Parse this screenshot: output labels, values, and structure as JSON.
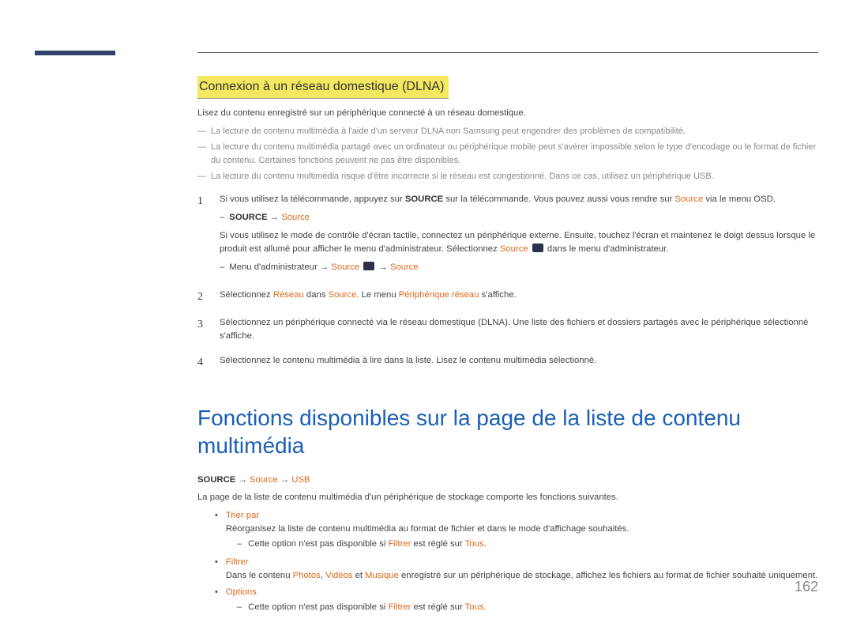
{
  "section": {
    "title": "Connexion à un réseau domestique (DLNA)",
    "intro": "Lisez du contenu enregistré sur un périphérique connecté à un réseau domestique.",
    "notes": [
      "La lecture de contenu multimédia à l'aide d'un serveur DLNA non Samsung peut engendrer des problèmes de compatibilité.",
      "La lecture du contenu multimédia partagé avec un ordinateur ou périphérique mobile peut s'avérer impossible selon le type d'encodage ou le format de fichier du contenu. Certaines fonctions peuvent ne pas être disponibles.",
      "La lecture du contenu multimédia risque d'être incorrecte si le réseau est congestionné. Dans ce cas, utilisez un périphérique USB."
    ]
  },
  "steps": {
    "s1": {
      "num": "1",
      "line1_a": "Si vous utilisez la télécommande, appuyez sur ",
      "line1_b": "SOURCE",
      "line1_c": " sur la télécommande. Vous pouvez aussi vous rendre sur ",
      "line1_d": "Source",
      "line1_e": " via le menu OSD.",
      "sub1_a": "SOURCE",
      "sub1_arrow": " → ",
      "sub1_b": "Source",
      "line2_a": "Si vous utilisez le mode de contrôle d'écran tactile, connectez un périphérique externe. Ensuite, touchez l'écran et maintenez le doigt dessus lorsque le produit est allumé pour afficher le menu d'administrateur. Sélectionnez ",
      "line2_b": "Source",
      "line2_c": " dans le menu d'administrateur.",
      "sub2_a": "Menu d'administrateur → ",
      "sub2_b": "Source",
      "sub2_c": " → ",
      "sub2_d": "Source"
    },
    "s2": {
      "num": "2",
      "a": "Sélectionnez ",
      "b": "Réseau",
      "c": " dans ",
      "d": "Source",
      "e": ". Le menu ",
      "f": "Périphérique réseau",
      "g": " s'affiche."
    },
    "s3": {
      "num": "3",
      "text": "Sélectionnez un périphérique connecté via le réseau domestique (DLNA). Une liste des fichiers et dossiers partagés avec le périphérique sélectionné s'affiche."
    },
    "s4": {
      "num": "4",
      "text": "Sélectionnez le contenu multimédia à lire dans la liste. Lisez le contenu multimédia sélectionné."
    }
  },
  "big": {
    "title": "Fonctions disponibles sur la page de la liste de contenu multimédia",
    "path_a": "SOURCE",
    "path_arr1": " → ",
    "path_b": "Source",
    "path_arr2": " → ",
    "path_c": "USB",
    "intro": "La page de la liste de contenu multimédia d'un périphérique de stockage comporte les fonctions suivantes.",
    "items": {
      "trier": {
        "label": "Trier par",
        "desc": "Réorganisez la liste de contenu multimédia au format de fichier et dans le mode d'affichage souhaités.",
        "sub_a": "Cette option n'est pas disponible si ",
        "sub_b": "Filtrer",
        "sub_c": " est réglé sur ",
        "sub_d": "Tous",
        "sub_e": "."
      },
      "filtrer": {
        "label": "Filtrer",
        "desc_a": "Dans le contenu ",
        "desc_b": "Photos",
        "desc_c": ", ",
        "desc_d": "Vidéos",
        "desc_e": " et ",
        "desc_f": "Musique",
        "desc_g": " enregistré sur un périphérique de stockage, affichez les fichiers au format de fichier souhaité uniquement."
      },
      "options": {
        "label": "Options",
        "sub_a": "Cette option n'est pas disponible si ",
        "sub_b": "Filtrer",
        "sub_c": " est réglé sur ",
        "sub_d": "Tous",
        "sub_e": "."
      }
    }
  },
  "page_number": "162"
}
